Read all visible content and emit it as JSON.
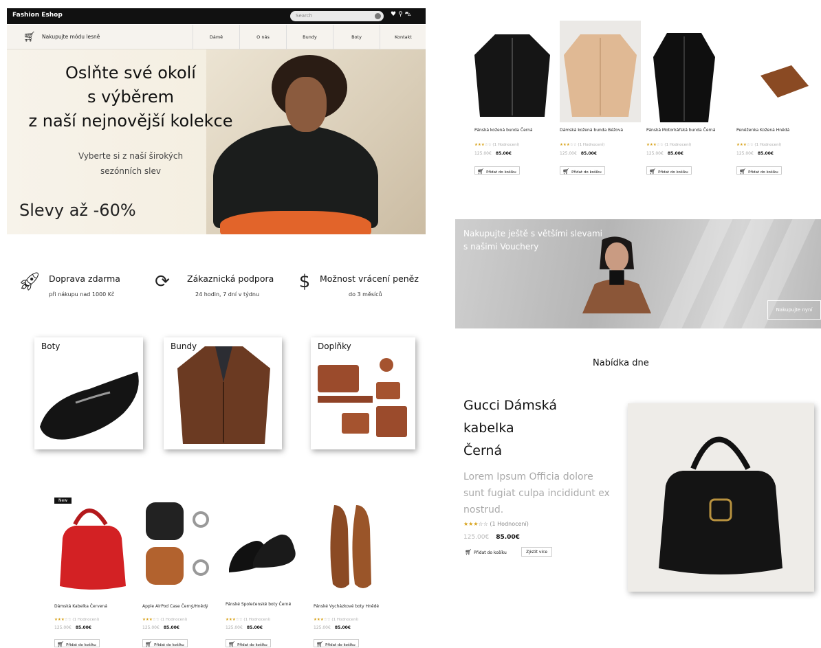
{
  "header": {
    "brand": "Fashion Eshop",
    "search_placeholder": "Search",
    "tagline": "Nakupujte módu lesně",
    "nav": [
      "Dámě",
      "O nás",
      "Bundy",
      "Boty",
      "Kontakt"
    ]
  },
  "hero": {
    "title_lines": [
      "Oslňte své okolí",
      "s výběrem",
      "z naší nejnovější kolekce"
    ],
    "sub_lines": [
      "Vyberte si z naší širokých",
      "sezónních slev"
    ],
    "sale": "Slevy až -60%"
  },
  "features": [
    {
      "icon": "rocket-icon",
      "title": "Doprava zdarma",
      "sub": "při nákupu nad 1000 Kč"
    },
    {
      "icon": "support-icon",
      "title": "Zákaznická podpora",
      "sub": "24 hodin, 7 dní v týdnu"
    },
    {
      "icon": "money-back-icon",
      "title": "Možnost vrácení peněz",
      "sub": "do 3 měsíců"
    }
  ],
  "categories": [
    {
      "label": "Boty"
    },
    {
      "label": "Bundy"
    },
    {
      "label": "Doplňky"
    }
  ],
  "products_bottom": [
    {
      "name": "Dámská Kabelka Červená",
      "rating": "(1 Hodnocení)",
      "stars": 3,
      "old_price": "125.00€",
      "price": "85.00€",
      "button": "Přidat do košíku",
      "badge": "New"
    },
    {
      "name": "Apple AirPod Case Černý/Hnědý",
      "rating": "(1 Hodnocení)",
      "stars": 3,
      "old_price": "125.00€",
      "price": "85.00€",
      "button": "Přidat do košíku"
    },
    {
      "name": "Pánské Společenské boty Černé",
      "rating": "(1 Hodnocení)",
      "stars": 3,
      "old_price": "125.00€",
      "price": "85.00€",
      "button": "Přidat do košíku"
    },
    {
      "name": "Pánské Vycházkové boty Hnědé",
      "rating": "(1 Hodnocení)",
      "stars": 3,
      "old_price": "125.00€",
      "price": "85.00€",
      "button": "Přidat do košíku"
    }
  ],
  "products_top": [
    {
      "name": "Pánská kožená bunda Černá",
      "rating": "(1 Hodnocení)",
      "stars": 3,
      "old_price": "125.00€",
      "price": "85.00€",
      "button": "Přidat do košíku"
    },
    {
      "name": "Dámská kožená bunda Béžová",
      "rating": "(1 Hodnocení)",
      "stars": 3,
      "old_price": "125.00€",
      "price": "85.00€",
      "button": "Přidat do košíku"
    },
    {
      "name": "Pánská Motorkářská bunda Černá",
      "rating": "(1 Hodnocení)",
      "stars": 3,
      "old_price": "125.00€",
      "price": "85.00€",
      "button": "Přidat do košíku"
    },
    {
      "name": "Peněženka Kožená Hnědá",
      "rating": "(1 Hodnocení)",
      "stars": 3,
      "old_price": "125.00€",
      "price": "85.00€",
      "button": "Přidat do košíku"
    }
  ],
  "voucher_banner": {
    "line1": "Nakupujte ještě s většími slevami",
    "line2": "s našimi Vouchery",
    "button": "Nakupujte nyní"
  },
  "deal": {
    "header": "Nabídka dne",
    "title_lines": [
      "Gucci Dámská",
      "kabelka",
      "Černá"
    ],
    "description": "Lorem Ipsum Officia dolore sunt fugiat culpa incididunt ex nostrud.",
    "rating": "(1 Hodnocení)",
    "stars": 3,
    "old_price": "125.00€",
    "price": "85.00€",
    "add_button": "Přidat do košíku",
    "more_button": "Zjistit více"
  },
  "colors": {
    "accent_star": "#d7a21a",
    "topbar": "#111111"
  }
}
